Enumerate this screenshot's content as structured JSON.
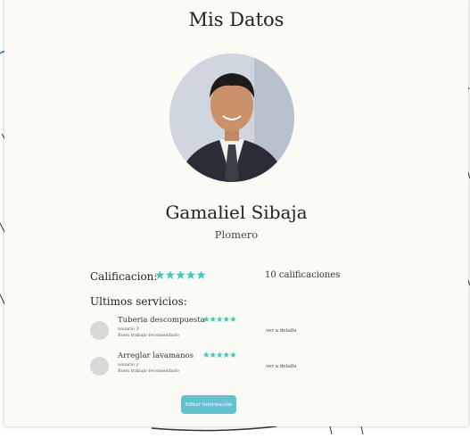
{
  "title": "Mis Datos",
  "profile": {
    "name": "Gamaliel Sibaja",
    "profession": "Plomero"
  },
  "rating": {
    "label": "Calificacion:",
    "stars": "★★★★★",
    "count_text": "10 calificaciones",
    "value": 5
  },
  "services": {
    "heading": "Ultimos servicios:",
    "items": [
      {
        "title": "Tuberia descompuesta",
        "user": "usuario 3",
        "review": "Buen trabajo recomendado",
        "stars": "★★★★★",
        "link": "ver a detalle"
      },
      {
        "title": "Arreglar lavamanos",
        "user": "usuario y",
        "review": "Buen trabajo recomendado",
        "stars": "★★★★★",
        "link": "ver a detalle"
      }
    ]
  },
  "edit_button": "Editar Información",
  "colors": {
    "accent": "#3fc6bd",
    "button": "#63c2d0",
    "panel": "#fbfbf5"
  },
  "icons": {
    "avatar": "profile-photo"
  }
}
